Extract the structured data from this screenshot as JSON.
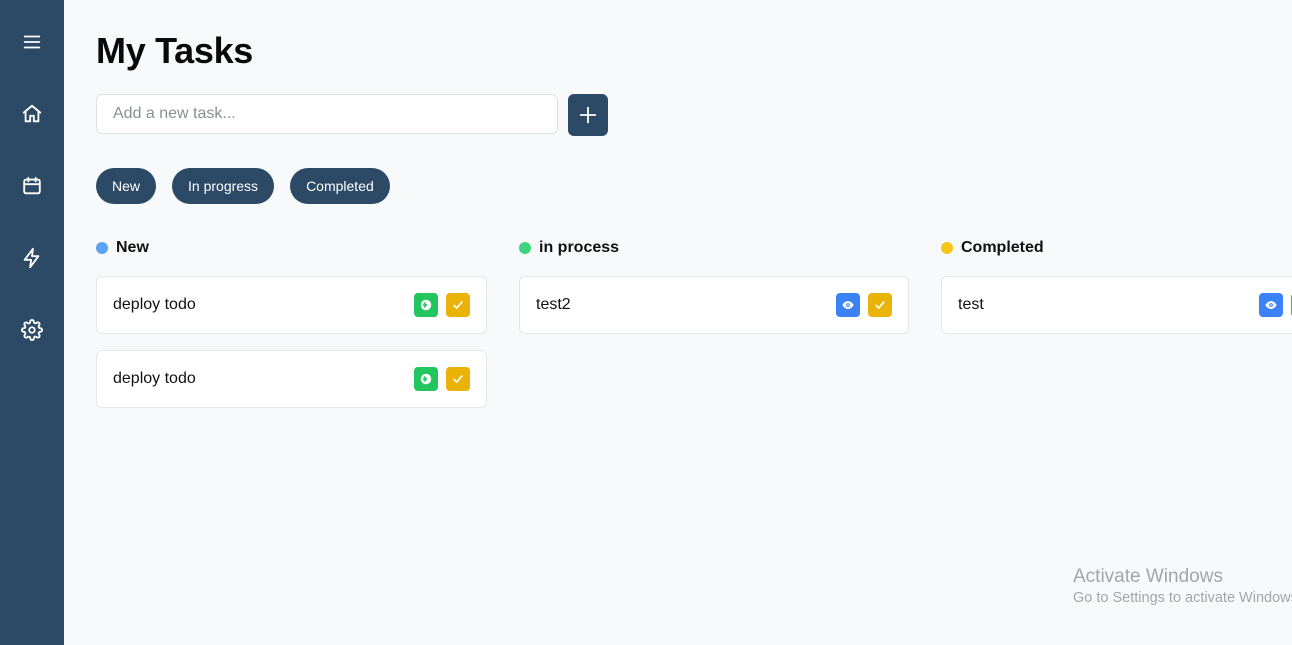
{
  "colors": {
    "sidebar": "#2c4a66",
    "accent": "#2c4a66",
    "dot_new": "#5ba3f5",
    "dot_in_process": "#3ed47f",
    "dot_completed": "#f5c518",
    "action_move": "#22c55e",
    "action_complete": "#eab308",
    "action_view": "#3b82f6"
  },
  "sidebar": {
    "items": [
      {
        "icon": "menu-icon"
      },
      {
        "icon": "home-icon"
      },
      {
        "icon": "calendar-icon"
      },
      {
        "icon": "lightning-icon"
      },
      {
        "icon": "gear-icon"
      }
    ]
  },
  "header": {
    "title": "My Tasks"
  },
  "new_task": {
    "placeholder": "Add a new task...",
    "value": "",
    "add_icon": "plus-icon"
  },
  "filters": {
    "new": "New",
    "in_progress": "In progress",
    "completed": "Completed"
  },
  "columns": {
    "new": {
      "title": "New",
      "cards": [
        {
          "text": "deploy todo",
          "actions": [
            "arrow-right-icon",
            "check-icon"
          ]
        },
        {
          "text": "deploy todo",
          "actions": [
            "arrow-right-icon",
            "check-icon"
          ]
        }
      ]
    },
    "in_process": {
      "title": "in process",
      "cards": [
        {
          "text": "test2",
          "actions": [
            "eye-icon",
            "check-icon"
          ]
        }
      ]
    },
    "completed": {
      "title": "Completed",
      "cards": [
        {
          "text": "test",
          "actions": [
            "eye-icon",
            "arrow-right-icon"
          ]
        }
      ]
    }
  },
  "watermark": {
    "title": "Activate Windows",
    "subtitle": "Go to Settings to activate Windows."
  }
}
